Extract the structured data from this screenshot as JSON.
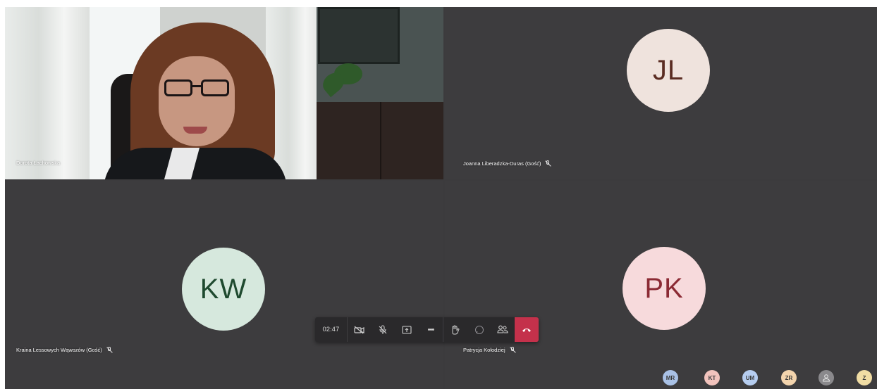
{
  "participants": [
    {
      "name": "Dorota Łachowska",
      "type": "video"
    },
    {
      "name": "Joanna Liberadzka-Duras (Gość)",
      "initials": "JL",
      "avatar_bg": "#efe3dd",
      "avatar_fg": "#5a2c22",
      "muted": true
    },
    {
      "name": "Kraina Lessowych Wąwozów (Gość)",
      "initials": "KW",
      "avatar_bg": "#d6e8dd",
      "avatar_fg": "#1f4a2f",
      "muted": true
    },
    {
      "name": "Patrycja Kołodziej",
      "initials": "PK",
      "avatar_bg": "#f7dadc",
      "avatar_fg": "#8b2a34",
      "muted": true
    }
  ],
  "controls": {
    "timer": "02:47",
    "camera": "camera-off-icon",
    "mic": "mic-off-icon",
    "share": "share-screen-icon",
    "more": "•••",
    "raise_hand": "raise-hand-icon",
    "chat": "chat-icon",
    "people": "people-icon",
    "hangup": "hang-up-icon",
    "hangup_color": "#c4314b"
  },
  "roster": [
    {
      "initials": "MR",
      "bg": "#a9c1e6"
    },
    {
      "initials": "KT",
      "bg": "#f2c3bd"
    },
    {
      "initials": "UM",
      "bg": "#b6cdf0"
    },
    {
      "initials": "ZR",
      "bg": "#f3d4ad"
    },
    {
      "initials": "",
      "bg": "#8a898c",
      "icon": "person-icon"
    },
    {
      "initials": "Z",
      "bg": "#f1dda4"
    }
  ]
}
